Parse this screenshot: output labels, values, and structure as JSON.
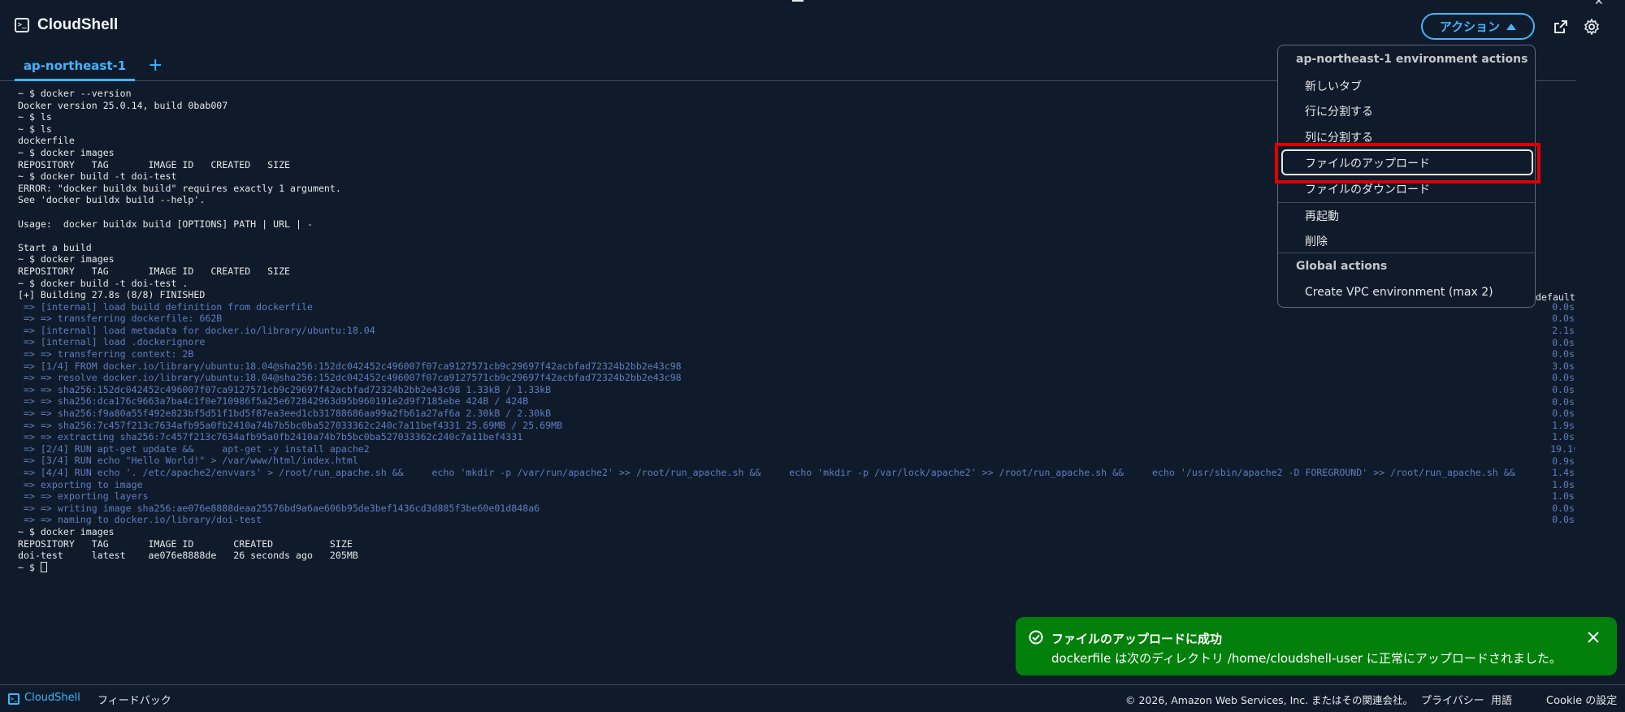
{
  "app": {
    "title": "CloudShell",
    "icon": "terminal-icon"
  },
  "header": {
    "actions_label": "アクション",
    "actions_icon": "caret-up-icon",
    "popout_icon": "external-link-icon",
    "settings_icon": "gear-icon"
  },
  "tabs": [
    {
      "label": "ap-northeast-1",
      "active": true
    }
  ],
  "tab_add_label": "+",
  "terminal": {
    "lines": [
      "~ $ docker --version",
      "Docker version 25.0.14, build 0bab007",
      "~ $ ls",
      "~ $ ls",
      "dockerfile",
      "~ $ docker images",
      "REPOSITORY   TAG       IMAGE ID   CREATED   SIZE",
      "~ $ docker build -t doi-test",
      "ERROR: \"docker buildx build\" requires exactly 1 argument.",
      "See 'docker buildx build --help'.",
      "",
      "Usage:  docker buildx build [OPTIONS] PATH | URL | -",
      "",
      "Start a build",
      "~ $ docker images",
      "REPOSITORY   TAG       IMAGE ID   CREATED   SIZE",
      "~ $ docker build -t doi-test .",
      "[+] Building 27.8s (8/8) FINISHED",
      " => [internal] load build definition from dockerfile",
      " => => transferring dockerfile: 662B",
      " => [internal] load metadata for docker.io/library/ubuntu:18.04",
      " => [internal] load .dockerignore",
      " => => transferring context: 2B",
      " => [1/4] FROM docker.io/library/ubuntu:18.04@sha256:152dc042452c496007f07ca9127571cb9c29697f42acbfad72324b2bb2e43c98",
      " => => resolve docker.io/library/ubuntu:18.04@sha256:152dc042452c496007f07ca9127571cb9c29697f42acbfad72324b2bb2e43c98",
      " => => sha256:152dc042452c496007f07ca9127571cb9c29697f42acbfad72324b2bb2e43c98 1.33kB / 1.33kB",
      " => => sha256:dca176c9663a7ba4c1f0e710986f5a25e672842963d95b960191e2d9f7185ebe 424B / 424B",
      " => => sha256:f9a80a55f492e823bf5d51f1bd5f87ea3eed1cb31788686aa99a2fb61a27af6a 2.30kB / 2.30kB",
      " => => sha256:7c457f213c7634afb95a0fb2410a74b7b5bc0ba527033362c240c7a11bef4331 25.69MB / 25.69MB",
      " => => extracting sha256:7c457f213c7634afb95a0fb2410a74b7b5bc0ba527033362c240c7a11bef4331",
      " => [2/4] RUN apt-get update &&     apt-get -y install apache2",
      " => [3/4] RUN echo \"Hello World!\" > /var/www/html/index.html",
      " => [4/4] RUN echo '. /etc/apache2/envvars' > /root/run_apache.sh &&     echo 'mkdir -p /var/run/apache2' >> /root/run_apache.sh &&     echo 'mkdir -p /var/lock/apache2' >> /root/run_apache.sh &&     echo '/usr/sbin/apache2 -D FOREGROUND' >> /root/run_apache.sh &&",
      " => exporting to image",
      " => => exporting layers",
      " => => writing image sha256:ae076e8888deaa25576bd9a6ae606b95de3bef1436cd3d885f3be60e01d848a6",
      " => => naming to docker.io/library/doi-test",
      "~ $ docker images",
      "REPOSITORY   TAG       IMAGE ID       CREATED          SIZE",
      "doi-test     latest    ae076e8888de   26 seconds ago   205MB",
      "~ $ "
    ],
    "blue_range": [
      18,
      36
    ],
    "timing_header": "default",
    "timings": [
      "0.0s",
      "0.0s",
      "2.1s",
      "0.0s",
      "0.0s",
      "3.0s",
      "0.0s",
      "0.0s",
      "0.0s",
      "0.0s",
      "1.9s",
      "1.0s",
      "19.1s",
      "0.9s",
      "1.4s",
      "1.0s",
      "1.0s",
      "0.0s",
      "0.0s"
    ]
  },
  "dropdown": {
    "section1_title": "ap-northeast-1 environment actions",
    "items1": [
      "新しいタブ",
      "行に分割する",
      "列に分割する",
      "ファイルのアップロード",
      "ファイルのダウンロード"
    ],
    "items2": [
      "再起動",
      "削除"
    ],
    "section2_title": "Global actions",
    "items3": [
      "Create VPC environment (max 2)"
    ],
    "highlighted": "ファイルのアップロード"
  },
  "toast": {
    "title": "ファイルのアップロードに成功",
    "message": "dockerfile は次のディレクトリ /home/cloudshell-user に正常にアップロードされました。",
    "icon": "check-circle-icon",
    "close_icon": "close-icon",
    "color": "#037f0c"
  },
  "footer": {
    "brand": "CloudShell",
    "feedback": "フィードバック",
    "copyright": "© 2026, Amazon Web Services, Inc. またはその関連会社。",
    "privacy": "プライバシー",
    "terms": "用語",
    "cookie": "Cookie の設定"
  },
  "colors": {
    "background": "#0f1b2a",
    "accent": "#42b4ff",
    "highlight": "#e00000",
    "success": "#037f0c"
  }
}
